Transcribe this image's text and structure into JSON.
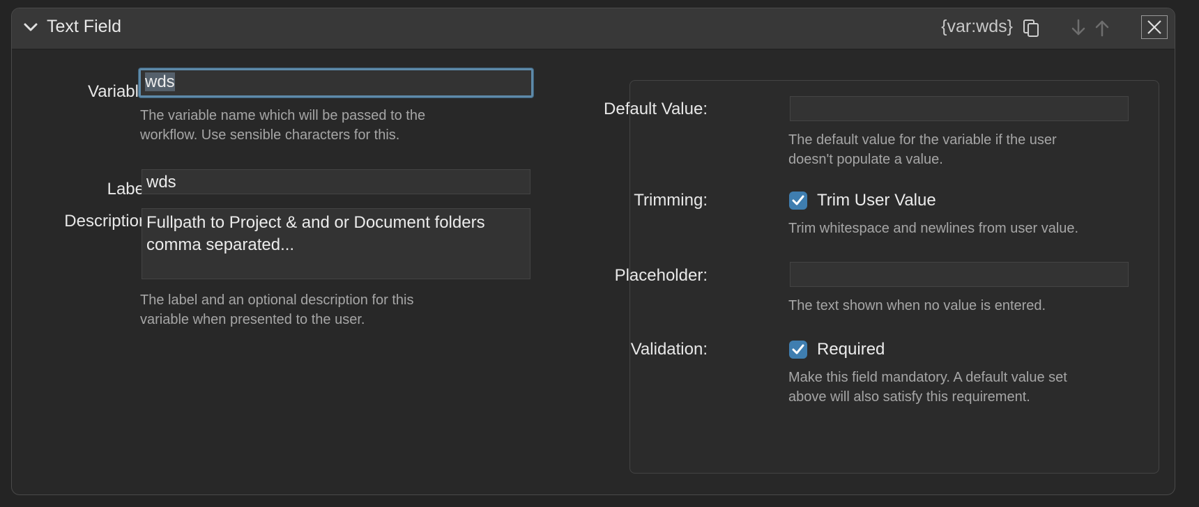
{
  "header": {
    "title": "Text Field",
    "variable_token": "{var:wds}"
  },
  "left": {
    "variable_label": "Variable:",
    "variable_value": "wds",
    "variable_help_1": "The variable name which will be passed to the",
    "variable_help_2": "workflow. Use sensible characters for this.",
    "label_label": "Label:",
    "label_value": "wds",
    "description_label": "Description:",
    "description_line_1": "Fullpath to Project & and or Document folders",
    "description_line_2": "comma separated...",
    "label_help_1": "The label and an optional description for this",
    "label_help_2": "variable when presented to the user."
  },
  "right": {
    "default_label": "Default Value:",
    "default_value": "",
    "default_help_1": "The default value for the variable if the user",
    "default_help_2": "doesn't populate a value.",
    "trimming_label": "Trimming:",
    "trimming_checkbox_label": "Trim User Value",
    "trimming_checked": true,
    "trimming_help": "Trim whitespace and newlines from user value.",
    "placeholder_label": "Placeholder:",
    "placeholder_value": "",
    "placeholder_help": "The text shown when no value is entered.",
    "validation_label": "Validation:",
    "validation_checkbox_label": "Required",
    "validation_checked": true,
    "validation_help_1": "Make this field mandatory. A default value set",
    "validation_help_2": "above will also satisfy this requirement."
  },
  "icons": {
    "collapse": "chevron-down-icon",
    "copy": "copy-icon",
    "move_down": "arrow-down-icon",
    "move_up": "arrow-up-icon",
    "close": "close-icon",
    "check": "checkmark-icon"
  },
  "colors": {
    "accent": "#3f7eb0",
    "focus_ring": "#5e8aa9",
    "background": "#282828",
    "header": "#383838"
  }
}
